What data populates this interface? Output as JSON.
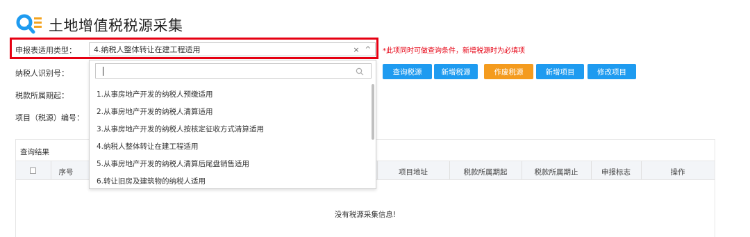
{
  "page": {
    "title": "土地增值税税源采集"
  },
  "form": {
    "report_type_label": "申报表适用类型：",
    "report_type_value": "4.纳税人整体转让在建工程适用",
    "clear_icon": "×",
    "caret_icon": "^",
    "hint": "*此项同时可做查询条件，新增税源时为必填项",
    "taxpayer_id_label": "纳税人识别号：",
    "period_start_label": "税款所属期起：",
    "project_no_label": "项目（税源）编号："
  },
  "dropdown": {
    "options": [
      "1.从事房地产开发的纳税人预缴适用",
      "2.从事房地产开发的纳税人清算适用",
      "3.从事房地产开发的纳税人按核定征收方式清算适用",
      "4.纳税人整体转让在建工程适用",
      "5.从事房地产开发的纳税人清算后尾盘销售适用",
      "6.转让旧房及建筑物的纳税人适用"
    ]
  },
  "buttons": {
    "query": "查询税源",
    "add": "新增税源",
    "void": "作废税源",
    "add_project": "新增项目",
    "edit_project": "修改项目"
  },
  "results": {
    "title": "查询结果",
    "columns": [
      "序号",
      "项目地址",
      "税款所属期起",
      "税款所属期止",
      "申报标志",
      "操作"
    ],
    "empty_message": "没有税源采集信息!"
  },
  "colors": {
    "accent_red": "#e60012",
    "button_blue": "#1e9bf0",
    "button_orange": "#f49b1e"
  }
}
